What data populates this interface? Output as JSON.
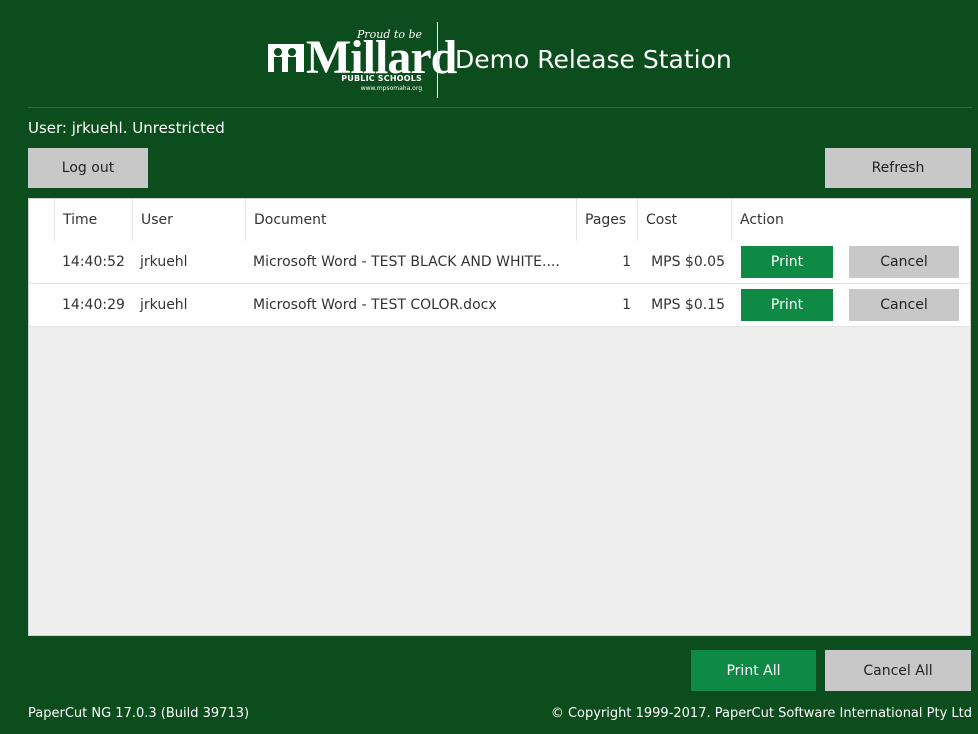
{
  "header": {
    "logo": {
      "tagline": "Proud to be",
      "wordmark": "Millard",
      "subtitle": "PUBLIC SCHOOLS",
      "url": "www.mpsomaha.org"
    },
    "station_title": "Demo Release Station"
  },
  "user_status": "User: jrkuehl. Unrestricted",
  "buttons": {
    "logout": "Log out",
    "refresh": "Refresh",
    "print_all": "Print All",
    "cancel_all": "Cancel All"
  },
  "table": {
    "columns": {
      "time": "Time",
      "user": "User",
      "document": "Document",
      "pages": "Pages",
      "cost": "Cost",
      "action": "Action"
    },
    "rows": [
      {
        "time": "14:40:52",
        "user": "jrkuehl",
        "document": "Microsoft Word - TEST BLACK AND WHITE....",
        "pages": "1",
        "cost": "MPS $0.05",
        "print_label": "Print",
        "cancel_label": "Cancel"
      },
      {
        "time": "14:40:29",
        "user": "jrkuehl",
        "document": "Microsoft Word - TEST COLOR.docx",
        "pages": "1",
        "cost": "MPS $0.15",
        "print_label": "Print",
        "cancel_label": "Cancel"
      }
    ]
  },
  "footer": {
    "version": "PaperCut NG  17.0.3 (Build 39713)",
    "copyright": "© Copyright 1999-2017. PaperCut Software International Pty Ltd"
  },
  "colors": {
    "background": "#0c4d1d",
    "action_green": "#0f8a44",
    "button_gray": "#c8c8c8"
  }
}
